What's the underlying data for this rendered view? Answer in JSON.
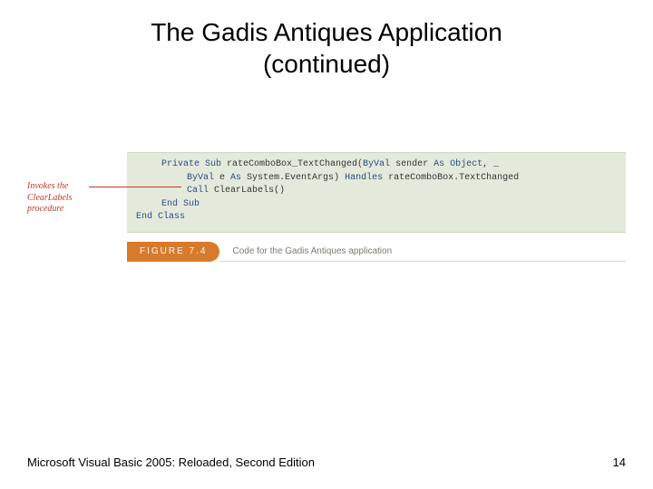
{
  "title_line1": "The Gadis Antiques Application",
  "title_line2": "(continued)",
  "callout": {
    "line1": "Invokes the",
    "line2": "ClearLabels",
    "line3": "procedure"
  },
  "code": {
    "l1_pre": "Private Sub ",
    "l1_mid": "rateComboBox_TextChanged(",
    "l1_kw2": "ByVal ",
    "l1_mid2": "sender ",
    "l1_kw3": "As Object",
    "l1_end": ", _",
    "l2_kw1": "ByVal ",
    "l2_mid": "e ",
    "l2_kw2": "As ",
    "l2_mid2": "System.EventArgs) ",
    "l2_kw3": "Handles ",
    "l2_end": "rateComboBox.TextChanged",
    "l3_kw": "Call ",
    "l3_end": "ClearLabels()",
    "l4": "End Sub",
    "l5": "End Class"
  },
  "figure": {
    "label": "FIGURE 7.4",
    "caption": "Code for the Gadis Antiques application"
  },
  "footer": {
    "left": "Microsoft Visual Basic 2005: Reloaded, Second Edition",
    "page": "14"
  }
}
